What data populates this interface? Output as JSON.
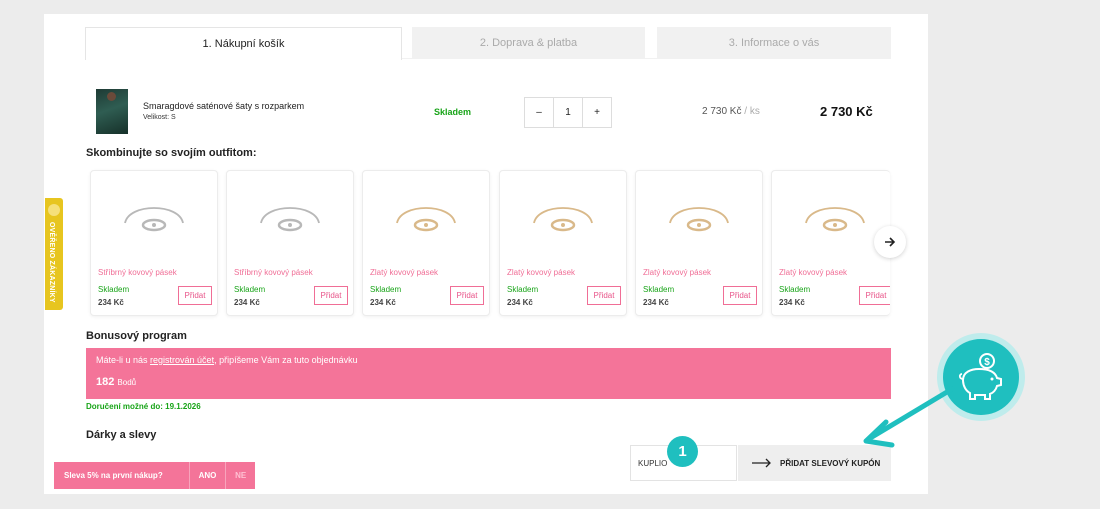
{
  "tabs": [
    {
      "label": "1. Nákupní košík",
      "active": true
    },
    {
      "label": "2. Doprava & platba",
      "active": false
    },
    {
      "label": "3. Informace o vás",
      "active": false
    }
  ],
  "cart_item": {
    "name": "Smaragdové saténové šaty s rozparkem",
    "variant": "Velikost: S",
    "stock": "Skladem",
    "quantity": "1",
    "minus": "–",
    "plus": "+",
    "unit_price": "2 730 Kč",
    "unit_suffix": "/ ks",
    "total_price": "2 730 Kč"
  },
  "combine": {
    "title": "Skombinujte so svojím outfitom:",
    "products": [
      {
        "name": "Stříbrný kovový pásek",
        "stock": "Skladem",
        "price": "234 Kč",
        "add_label": "Přidat",
        "tone": "silver"
      },
      {
        "name": "Stříbrný kovový pásek",
        "stock": "Skladem",
        "price": "234 Kč",
        "add_label": "Přidat",
        "tone": "silver"
      },
      {
        "name": "Zlatý kovový pásek",
        "stock": "Skladem",
        "price": "234 Kč",
        "add_label": "Přidat",
        "tone": "gold"
      },
      {
        "name": "Zlatý kovový pásek",
        "stock": "Skladem",
        "price": "234 Kč",
        "add_label": "Přidat",
        "tone": "gold"
      },
      {
        "name": "Zlatý kovový pásek",
        "stock": "Skladem",
        "price": "234 Kč",
        "add_label": "Přidat",
        "tone": "gold"
      },
      {
        "name": "Zlatý kovový pásek",
        "stock": "Skladem",
        "price": "234 Kč",
        "add_label": "Přidat",
        "tone": "gold"
      }
    ]
  },
  "bonus": {
    "title": "Bonusový program",
    "text_before": "Máte-li u nás ",
    "link": "registrován účet",
    "text_after": ", připíšeme Vám za tuto objednávku",
    "points": "182",
    "points_unit": "Bodů"
  },
  "delivery": "Doručení možné do: 19.1.2026",
  "gifts": {
    "title": "Dárky a slevy",
    "coupon_value": "KUPLIO",
    "coupon_button": "PŘIDAT SLEVOVÝ KUPÓN"
  },
  "side_badge": "OVĚŘENO ZÁKAZNÍKY",
  "discount_bar": {
    "question": "Sleva 5% na první nákup?",
    "yes": "ANO",
    "no": "NE"
  },
  "step_badge": "1",
  "colors": {
    "accent_pink": "#f47499",
    "stock_green": "#18a418",
    "teal": "#1fbfbf",
    "badge_yellow": "#e7c51f"
  },
  "icons": [
    "next-arrow-icon",
    "arrow-right-icon",
    "piggy-bank-icon",
    "coin-icon",
    "pointer-arrow-icon"
  ]
}
